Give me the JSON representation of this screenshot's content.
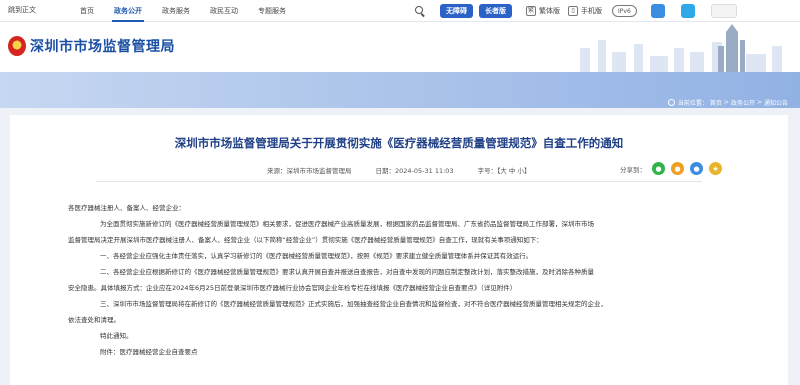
{
  "topbar": {
    "skip_link": "跳到正文",
    "nav": [
      "首页",
      "政务公开",
      "政务服务",
      "政民互动",
      "专题服务"
    ],
    "active_nav": 1,
    "barrier_free": "无障碍",
    "elder_mode": "长者版",
    "traditional": "繁体版",
    "mobile": "手机版",
    "ipv6": "IPv6",
    "app_icons": [
      "weibo-icon",
      "wechat-icon",
      "city-logo-icon"
    ]
  },
  "header": {
    "site_title": "深圳市市场监督管理局"
  },
  "breadcrumb": {
    "items": [
      "当前位置：",
      "首页",
      ">",
      "政务公开",
      ">",
      "通知公告"
    ]
  },
  "article": {
    "title": "深圳市市场监督管理局关于开展贯彻实施《医疗器械经营质量管理规范》自查工作的通知",
    "source": "来源：深圳市市场监督管理局",
    "date": "日期：2024-05-31 11:03",
    "font_size": "字号：【大  中  小】",
    "share_label": "分享到：",
    "paragraphs": [
      {
        "text": "各医疗器械注册人、备案人、经营企业：",
        "indent": false
      },
      {
        "text": "为全面贯彻实施新修订的《医疗器械经营质量管理规范》相关要求，促进医疗器械产业高质量发展，根据国家药品监督管理局、广东省药品监督管理局工作部署，深圳市市场",
        "indent": true
      },
      {
        "text": "监督管理局决定开展深圳市医疗器械注册人、备案人、经营企业（以下简称“经营企业”）贯彻实施《医疗器械经营质量管理规范》自查工作，现就有关事项通知如下：",
        "indent": false
      },
      {
        "text": "一、各经营企业应强化主体责任落实，认真学习新修订的《医疗器械经营质量管理规范》，按照《规范》要求建立健全质量管理体系并保证其有效运行。",
        "indent": true
      },
      {
        "text": "二、各经营企业应根据新修订的《医疗器械经营质量管理规范》要求认真开展自查并报送自查报告，对自查中发现的问题应制定整改计划，落实整改措施，及时消除各种质量",
        "indent": true
      },
      {
        "text": "安全隐患。具体填报方式：企业应在2024年6月25日前登录深圳市医疗器械行业协会官网企业年检专栏在线填报《医疗器械经营企业自查要点》（详见附件）",
        "indent": false
      },
      {
        "text": "三、深圳市市场监督管理局将在新修订的《医疗器械经营质量管理规范》正式实施后，加强抽查经营企业自查情况和监督检查，对不符合医疗器械经营质量管理相关规定的企业，",
        "indent": true
      },
      {
        "text": "依法查处和清理。",
        "indent": false
      },
      {
        "text": "特此通知。",
        "indent": true
      },
      {
        "text": "附件：医疗器械经营企业自查要点",
        "indent": true
      }
    ]
  },
  "colors": {
    "brand_blue": "#1f5ab4",
    "title_blue": "#1f3f86",
    "wechat_green": "#2fb44a",
    "weibo_orange": "#f0a020",
    "qq_blue": "#3a8de0"
  }
}
